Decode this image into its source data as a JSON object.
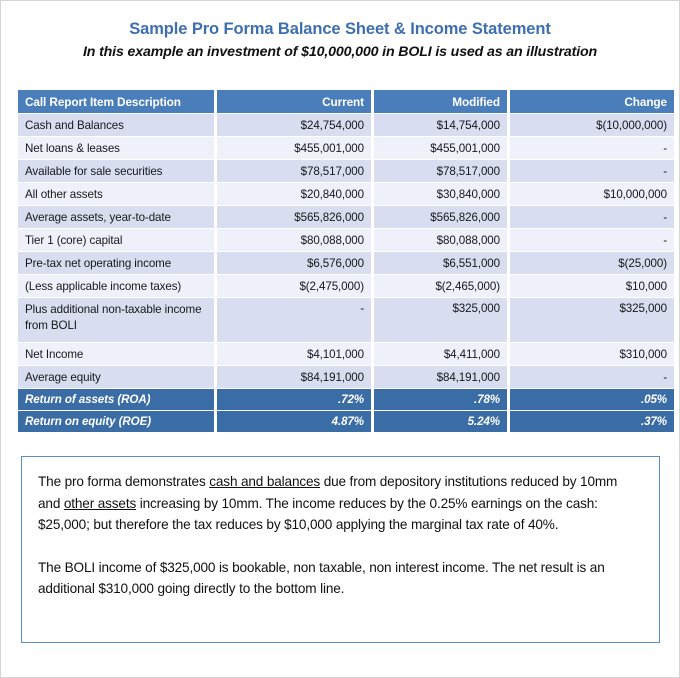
{
  "header": {
    "title": "Sample Pro Forma Balance Sheet & Income Statement",
    "subtitle": "In this example an investment of $10,000,000 in BOLI is used as an illustration"
  },
  "colors": {
    "title_blue": "#3e6fae",
    "header_blue": "#4a7ebb",
    "summary_blue": "#3a6ca5",
    "band_a": "#d8def0",
    "band_b": "#eef1f9",
    "note_border": "#5b8fc4"
  },
  "table": {
    "columns": [
      "Call Report Item Description",
      "Current",
      "Modified",
      "Change"
    ],
    "rows": [
      {
        "label": "Cash and Balances",
        "current": "$24,754,000",
        "modified": "$14,754,000",
        "change": "$(10,000,000)"
      },
      {
        "label": "Net loans & leases",
        "current": "$455,001,000",
        "modified": "$455,001,000",
        "change": "-"
      },
      {
        "label": "Available for sale securities",
        "current": "$78,517,000",
        "modified": "$78,517,000",
        "change": "-"
      },
      {
        "label": "All other assets",
        "current": "$20,840,000",
        "modified": "$30,840,000",
        "change": "$10,000,000"
      },
      {
        "label": "Average assets, year-to-date",
        "current": "$565,826,000",
        "modified": "$565,826,000",
        "change": "-"
      },
      {
        "label": "Tier 1 (core) capital",
        "current": "$80,088,000",
        "modified": "$80,088,000",
        "change": "-"
      },
      {
        "label": "Pre-tax net operating income",
        "current": "$6,576,000",
        "modified": "$6,551,000",
        "change": "$(25,000)"
      },
      {
        "label": "(Less applicable income taxes)",
        "current": "$(2,475,000)",
        "modified": "$(2,465,000)",
        "change": "$10,000"
      },
      {
        "label": "Plus additional non-taxable income from BOLI",
        "current": "-",
        "modified": "$325,000",
        "change": "$325,000"
      },
      {
        "label": "Net Income",
        "current": "$4,101,000",
        "modified": "$4,411,000",
        "change": "$310,000"
      },
      {
        "label": "Average equity",
        "current": "$84,191,000",
        "modified": "$84,191,000",
        "change": "-"
      }
    ],
    "summary_rows": [
      {
        "label": "Return of assets (ROA)",
        "current": ".72%",
        "modified": ".78%",
        "change": ".05%"
      },
      {
        "label": "Return on equity (ROE)",
        "current": "4.87%",
        "modified": "5.24%",
        "change": ".37%"
      }
    ]
  },
  "note": {
    "paragraph1": {
      "part1": "The pro forma demonstrates ",
      "underline1": "cash and balances",
      "part2": " due from depository institutions reduced by 10mm and ",
      "underline2": "other assets",
      "part3": " increasing by 10mm.  The income reduces by the 0.25% earnings on the cash:  $25,000; but therefore the tax reduces by $10,000 applying the marginal tax rate of 40%."
    },
    "paragraph2": "The BOLI income of $325,000 is bookable, non taxable, non interest income.  The net result is an additional $310,000 going directly to the bottom line."
  }
}
